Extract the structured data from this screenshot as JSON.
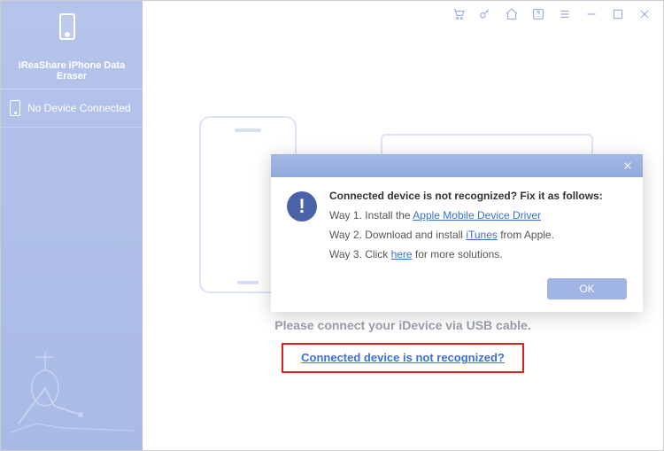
{
  "brand": "iReaShare iPhone Data Eraser",
  "sidebar": {
    "device_status": "No Device Connected"
  },
  "main": {
    "instruction": "Please connect your iDevice via USB cable.",
    "not_recognized_link": "Connected device is not recognized?"
  },
  "modal": {
    "heading": "Connected device is not recognized? Fix it as follows:",
    "way1_prefix": "Way 1. Install the ",
    "way1_link": "Apple Mobile Device Driver",
    "way2_prefix": "Way 2. Download and install ",
    "way2_link": "iTunes",
    "way2_suffix": " from Apple.",
    "way3_prefix": "Way 3. Click ",
    "way3_link": "here",
    "way3_suffix": " for more solutions.",
    "ok_label": "OK"
  },
  "icons": {
    "cart": "cart-icon",
    "key": "key-icon",
    "home": "home-icon",
    "help": "help-icon",
    "menu": "menu-icon",
    "minimize": "minimize-icon",
    "maximize": "maximize-icon",
    "close": "close-icon"
  }
}
